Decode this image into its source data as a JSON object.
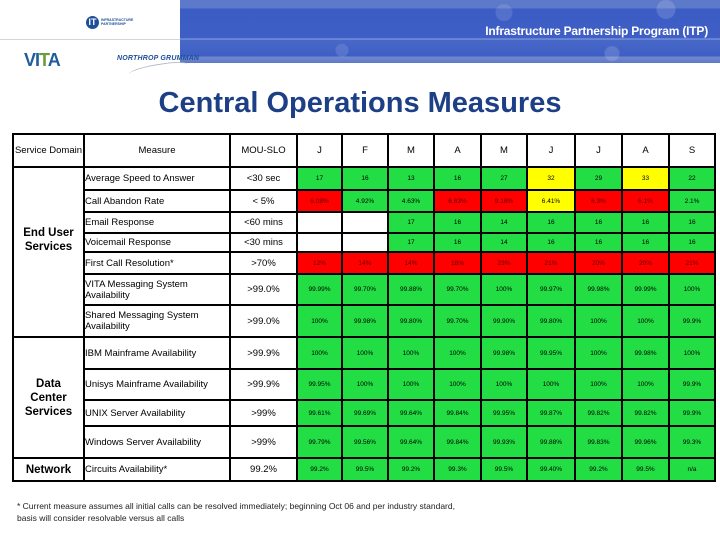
{
  "header": {
    "banner_title": "Infrastructure Partnership Program (ITP)",
    "logos": {
      "itp_mark": "IT",
      "itp_text": "INFRASTRUCTURE PARTNERSHIP",
      "vita": "VITA",
      "northrop": "NORTHROP GRUMMAN"
    }
  },
  "page_title": "Central Operations Measures",
  "colors": {
    "green": "#22dd44",
    "red": "#ff0000",
    "yellow": "#ffff00",
    "title_blue": "#1d3f86",
    "banner_blue": "#3f5fc6"
  },
  "table": {
    "columns": [
      "Service Domain",
      "Measure",
      "MOU-SLO",
      "J",
      "F",
      "M",
      "A",
      "M",
      "J",
      "J",
      "A",
      "S"
    ],
    "domains": [
      {
        "name": "End User Services"
      },
      {
        "name": "Data Center Services"
      },
      {
        "name": "Network"
      }
    ],
    "rows": [
      {
        "domain": 0,
        "measure": "Average Speed to Answer",
        "slo": "<30 sec",
        "values": [
          "17",
          "16",
          "13",
          "16",
          "27",
          "32",
          "29",
          "33",
          "22"
        ],
        "status": [
          "green",
          "green",
          "green",
          "green",
          "green",
          "yellow",
          "green",
          "yellow",
          "green"
        ]
      },
      {
        "domain": 0,
        "measure": "Call Abandon Rate",
        "slo": "< 5%",
        "values": [
          "6.08%",
          "4.92%",
          "4.63%",
          "6.63%",
          "9.16%",
          "6.41%",
          "6.3%",
          "6.1%",
          "2.1%"
        ],
        "status": [
          "red",
          "green",
          "green",
          "red",
          "red",
          "yellow",
          "red",
          "red",
          "green"
        ]
      },
      {
        "domain": 0,
        "measure": "Email Response",
        "slo": "<60 mins",
        "values": [
          "",
          "",
          "17",
          "16",
          "14",
          "16",
          "16",
          "16",
          "16"
        ],
        "status": [
          "blank",
          "blank",
          "green",
          "green",
          "green",
          "green",
          "green",
          "green",
          "green"
        ]
      },
      {
        "domain": 0,
        "measure": "Voicemail Response",
        "slo": "<30 mins",
        "values": [
          "",
          "",
          "17",
          "16",
          "14",
          "16",
          "16",
          "16",
          "16"
        ],
        "status": [
          "blank",
          "blank",
          "green",
          "green",
          "green",
          "green",
          "green",
          "green",
          "green"
        ]
      },
      {
        "domain": 0,
        "measure": "First Call Resolution*",
        "slo": ">70%",
        "values": [
          "12%",
          "14%",
          "14%",
          "18%",
          "23%",
          "21%",
          "20%",
          "20%",
          "21%"
        ],
        "status": [
          "red",
          "red",
          "red",
          "red",
          "red",
          "red",
          "red",
          "red",
          "red"
        ]
      },
      {
        "domain": 0,
        "measure": "VITA Messaging System Availability",
        "slo": ">99.0%",
        "values": [
          "99.99%",
          "99.70%",
          "99.88%",
          "99.70%",
          "100%",
          "99.97%",
          "99.98%",
          "99.99%",
          "100%"
        ],
        "status": [
          "green",
          "green",
          "green",
          "green",
          "green",
          "green",
          "green",
          "green",
          "green"
        ]
      },
      {
        "domain": 0,
        "measure": "Shared Messaging System Availability",
        "slo": ">99.0%",
        "values": [
          "100%",
          "99.98%",
          "99.80%",
          "99.70%",
          "99.90%",
          "99.80%",
          "100%",
          "100%",
          "99.9%"
        ],
        "status": [
          "green",
          "green",
          "green",
          "green",
          "green",
          "green",
          "green",
          "green",
          "green"
        ]
      },
      {
        "domain": 1,
        "measure": "IBM Mainframe Availability",
        "slo": ">99.9%",
        "values": [
          "100%",
          "100%",
          "100%",
          "100%",
          "99.98%",
          "99.95%",
          "100%",
          "99.98%",
          "100%"
        ],
        "status": [
          "green",
          "green",
          "green",
          "green",
          "green",
          "green",
          "green",
          "green",
          "green"
        ]
      },
      {
        "domain": 1,
        "measure": "Unisys Mainframe Availability",
        "slo": ">99.9%",
        "values": [
          "99.95%",
          "100%",
          "100%",
          "100%",
          "100%",
          "100%",
          "100%",
          "100%",
          "99.9%"
        ],
        "status": [
          "green",
          "green",
          "green",
          "green",
          "green",
          "green",
          "green",
          "green",
          "green"
        ]
      },
      {
        "domain": 1,
        "measure": "UNIX Server Availability",
        "slo": ">99%",
        "values": [
          "99.61%",
          "99.69%",
          "99.64%",
          "99.84%",
          "99.95%",
          "99.87%",
          "99.82%",
          "99.82%",
          "99.9%"
        ],
        "status": [
          "green",
          "green",
          "green",
          "green",
          "green",
          "green",
          "green",
          "green",
          "green"
        ]
      },
      {
        "domain": 1,
        "measure": "Windows Server Availability",
        "slo": ">99%",
        "values": [
          "99.79%",
          "99.56%",
          "99.64%",
          "99.84%",
          "99.93%",
          "99.88%",
          "99.83%",
          "99.96%",
          "99.3%"
        ],
        "status": [
          "green",
          "green",
          "green",
          "green",
          "green",
          "green",
          "green",
          "green",
          "green"
        ]
      },
      {
        "domain": 2,
        "measure": "Circuits Availability*",
        "slo": "99.2%",
        "values": [
          "99.2%",
          "99.5%",
          "99.2%",
          "99.3%",
          "99.5%",
          "99.40%",
          "99.2%",
          "99.5%",
          "n/a"
        ],
        "status": [
          "green",
          "green",
          "green",
          "green",
          "green",
          "green",
          "green",
          "green",
          "green"
        ]
      }
    ]
  },
  "footnote": {
    "line1": "* Current measure assumes all initial calls can be resolved immediately; beginning Oct 06 and per industry standard,",
    "line2": "basis will consider resolvable versus all calls"
  }
}
